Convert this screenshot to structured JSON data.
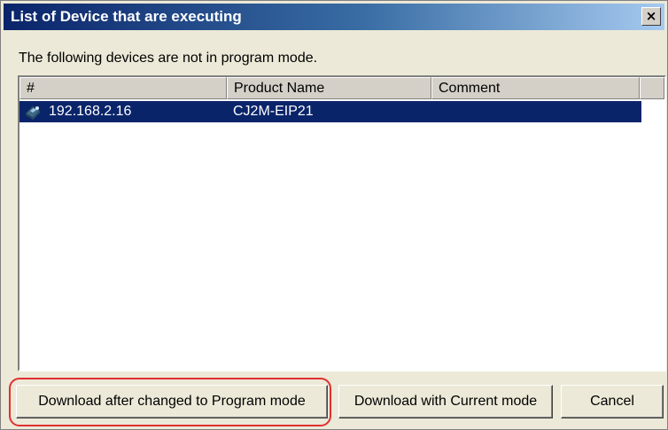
{
  "window": {
    "title": "List of Device that are executing",
    "close_label": "×"
  },
  "message": "The following devices are not in program mode.",
  "list": {
    "columns": [
      {
        "label": "#"
      },
      {
        "label": "Product Name"
      },
      {
        "label": "Comment"
      }
    ],
    "rows": [
      {
        "address": "192.168.2.16",
        "product_name": "CJ2M-EIP21",
        "comment": "",
        "icon": "device-icon",
        "selected": true
      }
    ]
  },
  "buttons": {
    "download_program_mode": "Download after changed to Program mode",
    "download_current_mode": "Download with Current mode",
    "cancel": "Cancel"
  },
  "colors": {
    "titlebar_start": "#0a246a",
    "selection": "#0a246a",
    "highlight": "#e03030"
  }
}
